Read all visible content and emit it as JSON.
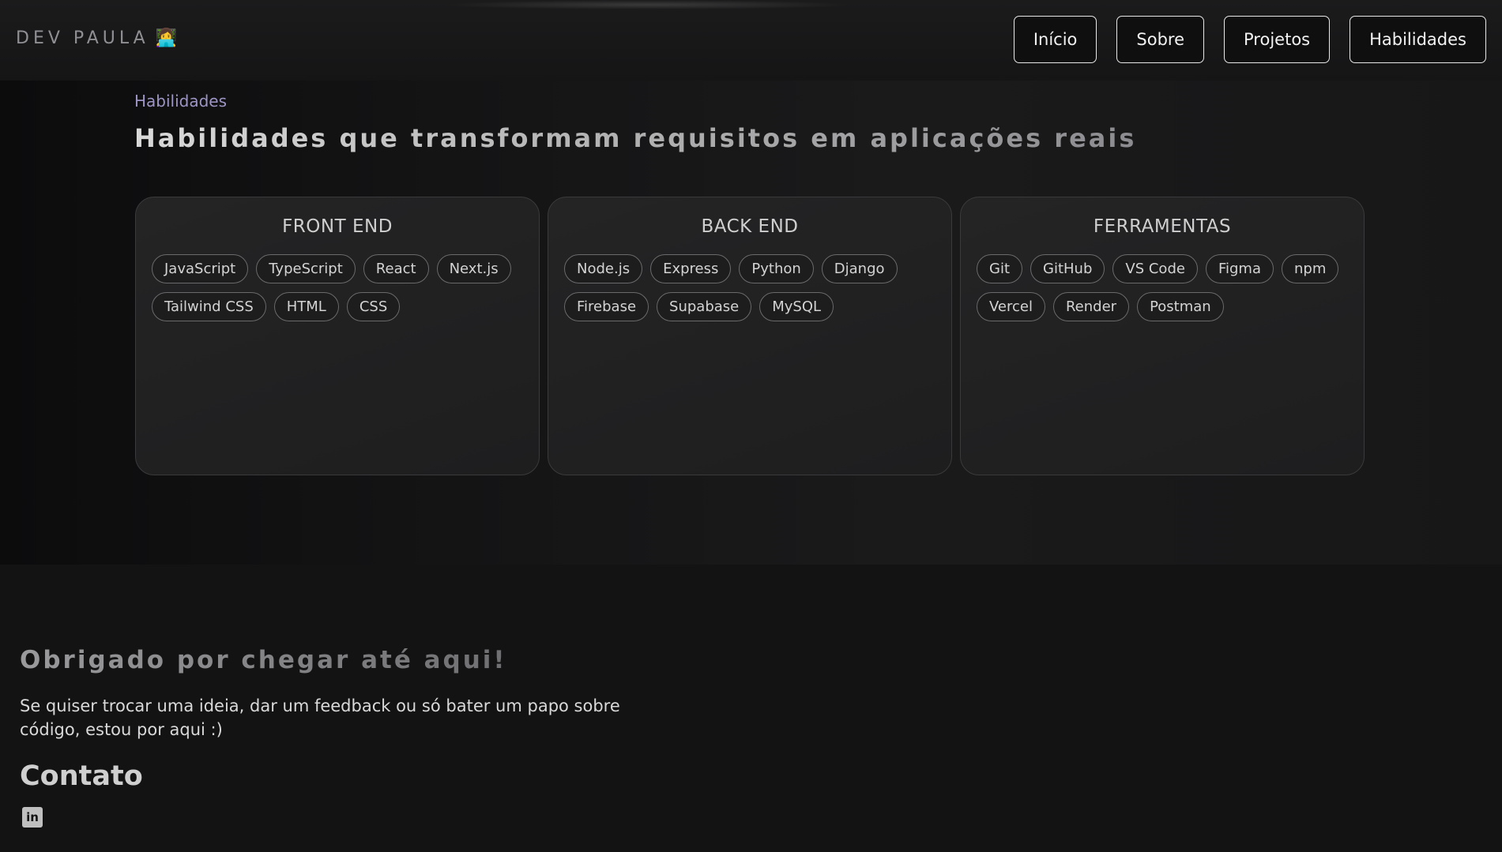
{
  "header": {
    "brand": "DEV PAULA",
    "brand_emoji": "👩‍💻",
    "nav": [
      "Início",
      "Sobre",
      "Projetos",
      "Habilidades"
    ]
  },
  "skills": {
    "label": "Habilidades",
    "title": "Habilidades que transformam requisitos em aplicações reais",
    "cards": [
      {
        "title": "FRONT END",
        "tags": [
          "JavaScript",
          "TypeScript",
          "React",
          "Next.js",
          "Tailwind CSS",
          "HTML",
          "CSS"
        ]
      },
      {
        "title": "BACK END",
        "tags": [
          "Node.js",
          "Express",
          "Python",
          "Django",
          "Firebase",
          "Supabase",
          "MySQL"
        ]
      },
      {
        "title": "FERRAMENTAS",
        "tags": [
          "Git",
          "GitHub",
          "VS Code",
          "Figma",
          "npm",
          "Vercel",
          "Render",
          "Postman"
        ]
      }
    ]
  },
  "footer": {
    "title": "Obrigado por chegar até aqui!",
    "text": "Se quiser trocar uma ideia, dar um feedback ou só bater um papo sobre código, estou por aqui :)",
    "contact_title": "Contato",
    "linkedin_icon": "linkedin-icon",
    "linkedin_glyph": "in"
  }
}
